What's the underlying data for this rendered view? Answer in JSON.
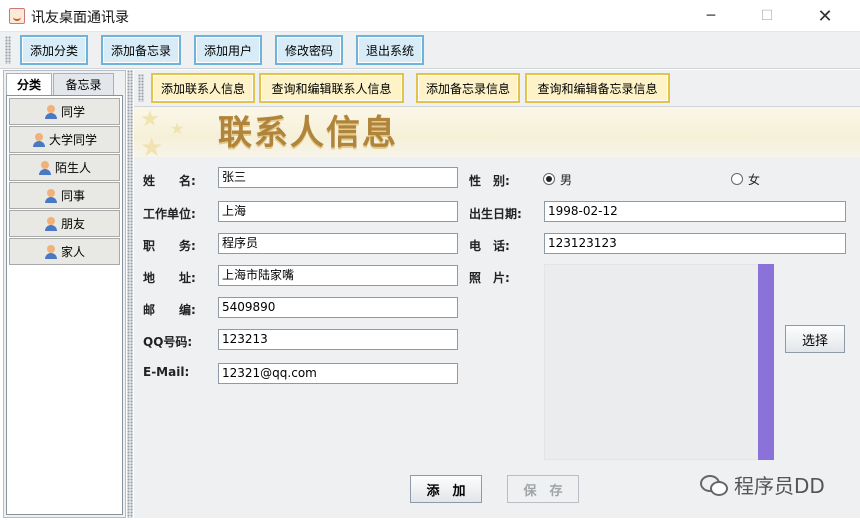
{
  "window": {
    "title": "讯友桌面通讯录"
  },
  "toolbar": {
    "items": [
      "添加分类",
      "添加备忘录",
      "添加用户",
      "修改密码",
      "退出系统"
    ]
  },
  "left_tabs": [
    "分类",
    "备忘录"
  ],
  "categories": [
    "同学",
    "大学同学",
    "陌生人",
    "同事",
    "朋友",
    "家人"
  ],
  "sub_toolbar": [
    "添加联系人信息",
    "查询和编辑联系人信息",
    "添加备忘录信息",
    "查询和编辑备忘录信息"
  ],
  "banner": {
    "title": "联系人信息"
  },
  "form": {
    "name_label": "姓　　名:",
    "name": "张三",
    "gender_label": "性　别:",
    "gender_male": "男",
    "gender_female": "女",
    "work_label": "工作单位:",
    "work": "上海",
    "birth_label": "出生日期:",
    "birth": "1998-02-12",
    "job_label": "职　　务:",
    "job": "程序员",
    "phone_label": "电　话:",
    "phone": "123123123",
    "address_label": "地　　址:",
    "address": "上海市陆家嘴",
    "photo_label": "照　片:",
    "zip_label": "邮　　编:",
    "zip": "5409890",
    "qq_label": "QQ号码:",
    "qq": "123213",
    "email_label": "E-Mail:",
    "email": "12321@qq.com",
    "choose_button": "选择",
    "add_button": "添　加",
    "save_button": "保　存"
  },
  "watermark": "程序员DD",
  "colors": {
    "toolbar_button_border": "#6fb3d9",
    "subbar_button_border": "#e2c34b",
    "photo_bar": "#8a72d8"
  }
}
